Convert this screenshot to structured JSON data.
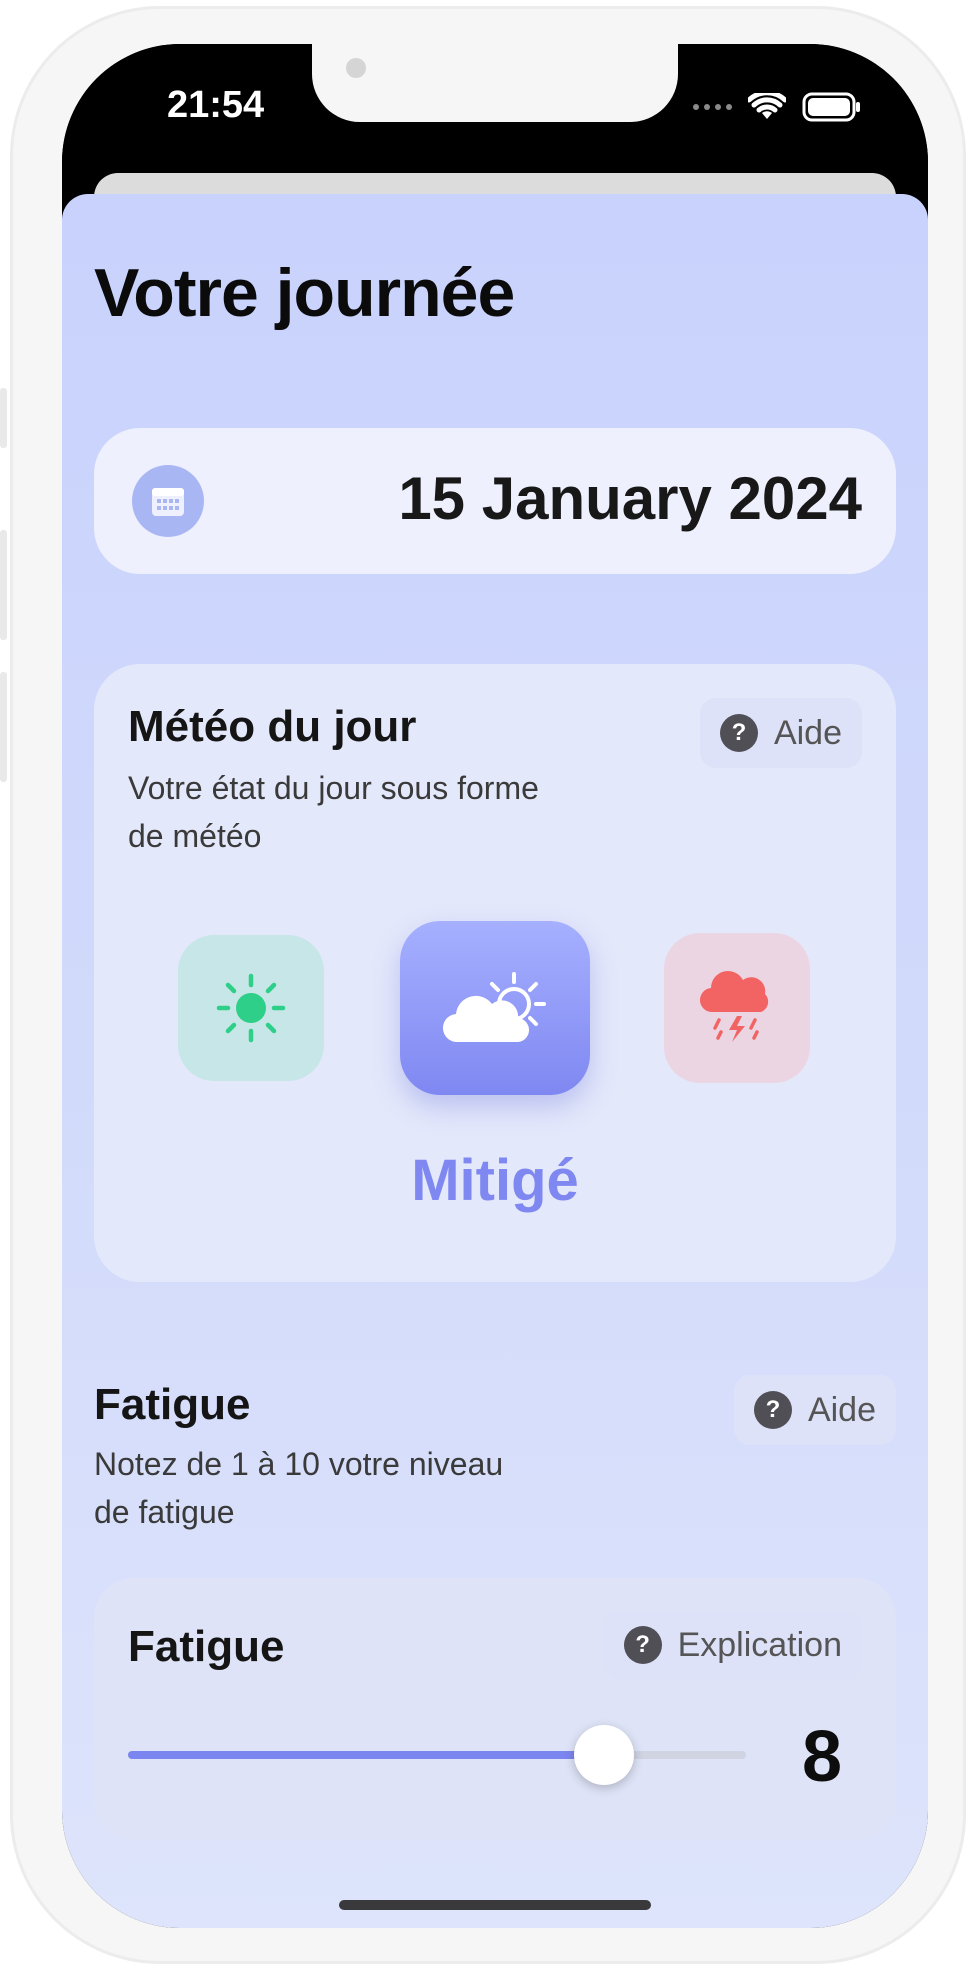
{
  "status_bar": {
    "time": "21:54"
  },
  "page": {
    "title": "Votre journée"
  },
  "date_picker": {
    "date": "15 January 2024",
    "icon": "calendar-icon"
  },
  "meteo": {
    "title": "Météo du jour",
    "subtitle_line1": "Votre état du jour sous forme",
    "subtitle_line2": "de météo",
    "help_label": "Aide",
    "options": [
      {
        "icon": "sun-icon",
        "color": "#2ecf88"
      },
      {
        "icon": "partly-cloudy-icon",
        "color": "#ffffff"
      },
      {
        "icon": "storm-icon",
        "color": "#f26464"
      }
    ],
    "selected_label": "Mitigé",
    "accent": "#7f88f1"
  },
  "fatigue": {
    "title": "Fatigue",
    "subtitle_line1": "Notez de 1 à 10 votre niveau",
    "subtitle_line2": "de fatigue",
    "help_label": "Aide",
    "card_title": "Fatigue",
    "explain_label": "Explication",
    "value": "8",
    "slider_fraction": 0.77
  }
}
